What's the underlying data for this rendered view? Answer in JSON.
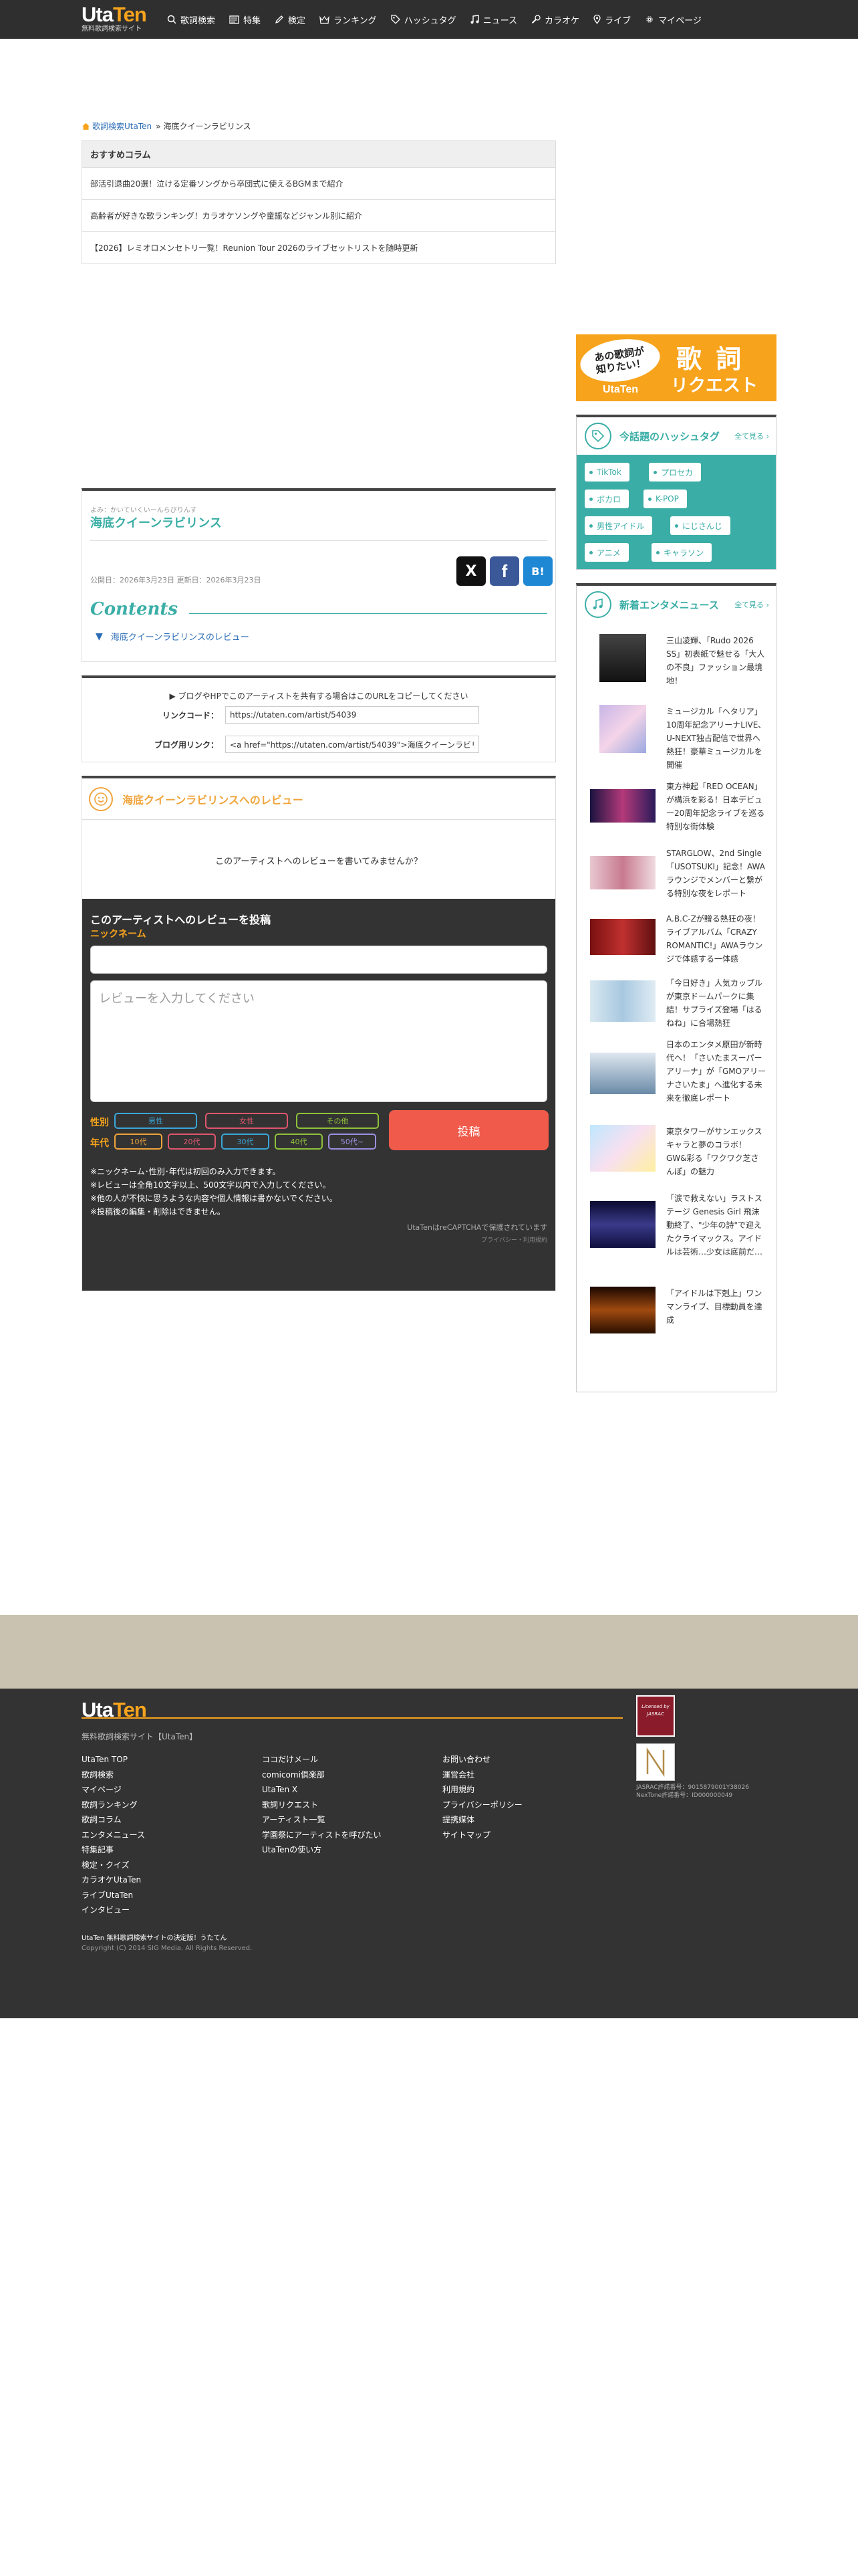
{
  "header": {
    "logo": {
      "part1": "Uta",
      "part2": "Ten"
    },
    "tagline": "無料歌詞検索サイト",
    "nav": [
      {
        "label": "歌詞検索",
        "icon": "search-icon"
      },
      {
        "label": "特集",
        "icon": "newspaper-icon"
      },
      {
        "label": "検定",
        "icon": "pencil-icon"
      },
      {
        "label": "ランキング",
        "icon": "crown-icon"
      },
      {
        "label": "ハッシュタグ",
        "icon": "tag-icon"
      },
      {
        "label": "ニュース",
        "icon": "music-note-icon"
      },
      {
        "label": "カラオケ",
        "icon": "microphone-icon"
      },
      {
        "label": "ライブ",
        "icon": "pin-icon"
      },
      {
        "label": "マイページ",
        "icon": "gear-icon"
      }
    ]
  },
  "breadcrumb": {
    "home": "歌詞検索UtaTen",
    "sep": "»",
    "current": "海底クイーンラビリンス"
  },
  "recommend": {
    "heading": "おすすめコラム",
    "items": [
      "部活引退曲20選！泣ける定番ソングから卒団式に使えるBGMまで紹介",
      "高齢者が好きな歌ランキング！カラオケソングや童謡などジャンル別に紹介",
      "【2026】レミオロメンセトリ一覧！Reunion Tour 2026のライブセットリストを随時更新"
    ]
  },
  "artist": {
    "kana": "よみ：かいていくいーんらびりんす",
    "name": "海底クイーンラビリンス",
    "dates": "公開日：2026年3月23日 更新日：2026年3月23日",
    "contents_title": "Contents",
    "toc": [
      "海底クイーンラビリンスのレビュー"
    ],
    "share_labels": {
      "x": "X",
      "facebook": "f",
      "hatena": "B!"
    }
  },
  "share": {
    "message": "▶ ブログやHPでこのアーティストを共有する場合はこのURLをコピーしてください",
    "link_label": "リンクコード：",
    "link_value": "https://utaten.com/artist/54039",
    "blog_label": "ブログ用リンク：",
    "blog_value": "<a href=\"https://utaten.com/artist/54039\">海底クイーンラビリンス</a>"
  },
  "review": {
    "title": "海底クイーンラビリンスへのレビュー",
    "empty": "このアーティストへのレビューを書いてみませんか？",
    "form_title": "このアーティストへのレビューを投稿",
    "nickname_label": "ニックネーム",
    "text_placeholder": "レビューを入力してください",
    "gender_label": "性別",
    "genders": [
      "男性",
      "女性",
      "その他"
    ],
    "age_label": "年代",
    "ages": [
      "10代",
      "20代",
      "30代",
      "40代",
      "50代~"
    ],
    "post_label": "投稿",
    "notes": [
      "※ニックネーム･性別･年代は初回のみ入力できます。",
      "※レビューは全角10文字以上、500文字以内で入力してください。",
      "※他の人が不快に思うような内容や個人情報は書かないでください。",
      "※投稿後の編集・削除はできません。"
    ],
    "recaptcha": "UtaTenはreCAPTCHAで保護されています",
    "recaptcha_sub": "プライバシー・利用規約",
    "colors": {
      "male": "#3aa6d8",
      "female": "#e0566e",
      "other": "#8fc23a",
      "age10": "#f0a43a",
      "age20": "#e0566e",
      "age30": "#3aa6d8",
      "age40": "#8fc23a",
      "age50": "#9b8fe0"
    }
  },
  "sidebar": {
    "request_banner": {
      "line1": "あの歌詞が",
      "line2": "知りたい！",
      "brand": "UtaTen",
      "big1": "歌 詞",
      "big2": "リクエスト"
    },
    "hashtags": {
      "title": "今話題のハッシュタグ",
      "more": "全て見る",
      "tags": [
        "TikTok",
        "プロセカ",
        "ボカロ",
        "K-POP",
        "男性アイドル",
        "にじさんじ",
        "アニメ",
        "キャラソン"
      ]
    },
    "news": {
      "title": "新着エンタメニュース",
      "more": "全て見る",
      "items": [
        "三山凌輝、「Rudo 2026 SS」初表紙で魅せる「大人の不良」ファッション最境地！",
        "ミュージカル「ヘタリア」10周年記念アリーナLIVE、U-NEXT独占配信で世界へ熱狂！豪華ミュージカルを開催",
        "東方神起「RED OCEAN」が構浜を彩る！日本デビュー20周年記念ライブを巡る特別な街体験",
        "STARGLOW、2nd Single「USOTSUKI」記念！AWAラウンジでメンバーと繋がる特別な夜をレポート",
        "A.B.C-Zが贈る熱狂の夜！ライブアルバム「CRAZY ROMANTIC!」AWAラウンジで体感する一体感",
        "「今日好き」人気カップルが東京ドームパークに集結！サプライズ登場「はるねね」に合場熱狂",
        "日本のエンタメ原田が新時代へ！「さいたまスーパーアリーナ」が「GMOアリーナさいたま」へ進化する未来を徹底レポート",
        "東京タワーがサンエックスキャラと夢のコラボ！GW&彩る「ワクワク芝さんぽ」の魅力",
        "「涙で救えない」ラストステージ Genesis Girl 飛沫動終了、\"少年の詩\"で迎えたクライマックス。アイドルは芸術…少女は底前だ…",
        "「アイドルは下剋上」ワンマンライブ、目標動員を達成"
      ]
    }
  },
  "footer": {
    "logo": {
      "part1": "Uta",
      "part2": "Ten"
    },
    "tagline": "無料歌詞検索サイト【UtaTen】",
    "col1": [
      "UtaTen TOP",
      "歌詞検索",
      "マイページ",
      "歌詞ランキング",
      "歌詞コラム",
      "エンタメニュース",
      "特集記事",
      "検定・クイズ",
      "カラオケUtaTen",
      "ライブUtaTen",
      "インタビュー"
    ],
    "col2": [
      "ココだけメール",
      "comicomi倶楽部",
      "UtaTen X",
      "歌詞リクエスト",
      "アーティスト一覧",
      "学園祭にアーティストを呼びたい",
      "UtaTenの使い方"
    ],
    "col3": [
      "お問い合わせ",
      "運営会社",
      "利用規約",
      "プライバシーポリシー",
      "提携媒体",
      "サイトマップ"
    ],
    "jasrac": "Licensed by JASRAC",
    "license1": "JASRAC許諾番号：9015879001Y38026",
    "license2": "NexTone許諾番号：ID000000049",
    "bottom1": "UtaTen 無料歌詞検索サイトの決定版！うたてん",
    "copyright": "Copyright (C) 2014 SIG Media. All Rights Reserved."
  }
}
